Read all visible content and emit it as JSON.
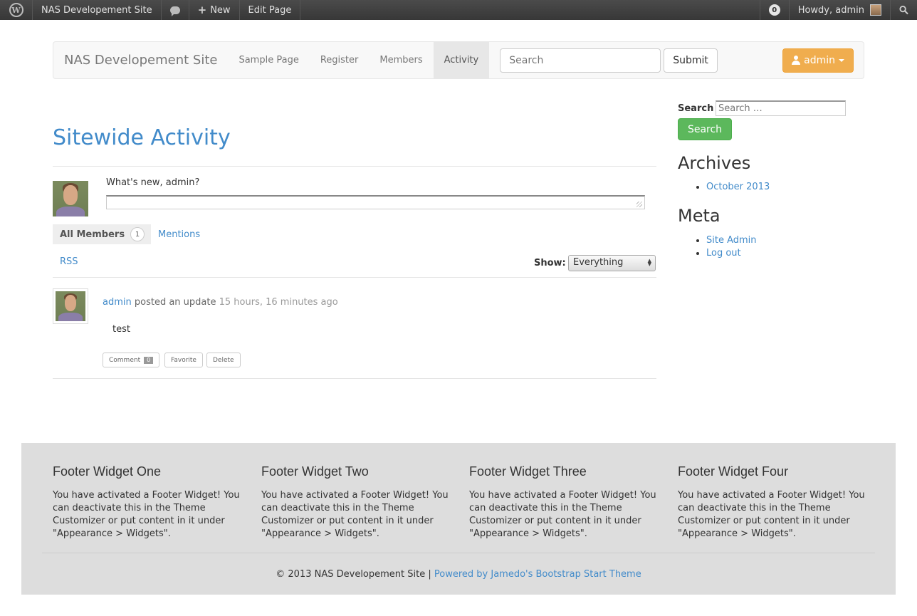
{
  "adminbar": {
    "site_name": "NAS Developement Site",
    "new_label": "New",
    "edit_label": "Edit Page",
    "notifications": "0",
    "howdy": "Howdy, admin"
  },
  "navbar": {
    "brand": "NAS Developement Site",
    "links": [
      "Sample Page",
      "Register",
      "Members",
      "Activity"
    ],
    "active": "Activity",
    "search_placeholder": "Search",
    "submit_label": "Submit",
    "admin_label": "admin"
  },
  "main": {
    "title": "Sitewide Activity",
    "whats_new": "What's new, admin?",
    "tabs": {
      "all_members": "All Members",
      "all_members_count": "1",
      "mentions": "Mentions"
    },
    "rss": "RSS",
    "show_label": "Show:",
    "show_value": "Everything",
    "entry": {
      "author": "admin",
      "action": "posted an update",
      "time": "15 hours, 16 minutes ago",
      "body": "test",
      "comment_label": "Comment",
      "comment_count": "0",
      "favorite_label": "Favorite",
      "delete_label": "Delete"
    }
  },
  "sidebar": {
    "search_label": "Search",
    "search_placeholder": "Search …",
    "search_button": "Search",
    "archives_title": "Archives",
    "archives": [
      "October 2013"
    ],
    "meta_title": "Meta",
    "meta": [
      "Site Admin",
      "Log out"
    ]
  },
  "footer": {
    "widgets": [
      {
        "title": "Footer Widget One",
        "text": "You have activated a Footer Widget! You can deactivate this in the Theme Customizer or put content in it under \"Appearance > Widgets\"."
      },
      {
        "title": "Footer Widget Two",
        "text": "You have activated a Footer Widget! You can deactivate this in the Theme Customizer or put content in it under \"Appearance > Widgets\"."
      },
      {
        "title": "Footer Widget Three",
        "text": "You have activated a Footer Widget! You can deactivate this in the Theme Customizer or put content in it under \"Appearance > Widgets\"."
      },
      {
        "title": "Footer Widget Four",
        "text": "You have activated a Footer Widget! You can deactivate this in the Theme Customizer or put content in it under \"Appearance > Widgets\"."
      }
    ],
    "copyright": "© 2013 NAS Developement Site |",
    "credit_link": "Powered by Jamedo's Bootstrap Start Theme"
  },
  "colors": {
    "link": "#428bca",
    "admin_button": "#f0ad4e",
    "search_button": "#5cb85c",
    "footer_bg": "#dddddd"
  },
  "icons": [
    "wordpress-icon",
    "comment-icon",
    "plus-icon",
    "user-icon",
    "caret-down-icon",
    "search-icon"
  ]
}
